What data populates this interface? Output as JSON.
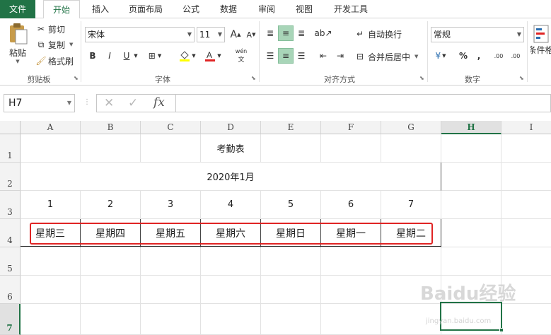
{
  "tabs": [
    {
      "label": "文件"
    },
    {
      "label": "开始"
    },
    {
      "label": "插入"
    },
    {
      "label": "页面布局"
    },
    {
      "label": "公式"
    },
    {
      "label": "数据"
    },
    {
      "label": "审阅"
    },
    {
      "label": "视图"
    },
    {
      "label": "开发工具"
    }
  ],
  "clipboard": {
    "paste": "粘贴",
    "cut": "剪切",
    "copy": "复制",
    "format_painter": "格式刷",
    "group": "剪贴板"
  },
  "font": {
    "name": "宋体",
    "size": "11",
    "group": "字体",
    "bold": "B",
    "italic": "I",
    "underline": "U",
    "grow": "A",
    "shrink": "A",
    "phonetic": "wén"
  },
  "alignment": {
    "wrap": "自动换行",
    "merge": "合并后居中",
    "group": "对齐方式"
  },
  "number": {
    "format": "常规",
    "percent": "%",
    "comma": ",",
    "inc_decimal": ".00",
    "dec_decimal": ".00",
    "group": "数字"
  },
  "styles": {
    "conditional": "条件格"
  },
  "formula_bar": {
    "name_box": "H7",
    "fx": "fx",
    "content": ""
  },
  "columns": [
    "A",
    "B",
    "C",
    "D",
    "E",
    "F",
    "G",
    "H",
    "I"
  ],
  "rows": [
    "1",
    "2",
    "3",
    "4",
    "5",
    "6",
    "7"
  ],
  "selected_cell": "H7",
  "sheet": {
    "title": "考勤表",
    "month": "2020年1月",
    "days": [
      "1",
      "2",
      "3",
      "4",
      "5",
      "6",
      "7"
    ],
    "weekdays": [
      "星期三",
      "星期四",
      "星期五",
      "星期六",
      "星期日",
      "星期一",
      "星期二"
    ]
  },
  "watermark": {
    "main": "Baidu经验",
    "sub": "jingyan.baidu.com"
  },
  "colors": {
    "excel_green": "#217346",
    "highlight_red": "#e02424",
    "active_button": "#a8d5b8"
  }
}
